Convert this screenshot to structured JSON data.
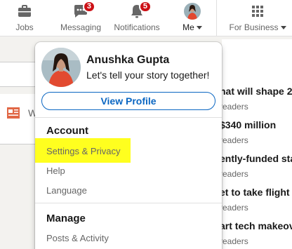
{
  "nav": {
    "jobs_label": "Jobs",
    "messaging_label": "Messaging",
    "messaging_badge": "3",
    "notifications_label": "Notifications",
    "notifications_badge": "5",
    "me_label": "Me",
    "business_label": "For Business",
    "icon_color": "#666666",
    "badge_color": "#cc1016"
  },
  "menu": {
    "name": "Anushka Gupta",
    "headline": "Let's tell your story together!",
    "view_profile": "View Profile",
    "account_title": "Account",
    "account_items": [
      "Settings & Privacy",
      "Help",
      "Language"
    ],
    "manage_title": "Manage",
    "manage_items": [
      "Posts & Activity"
    ],
    "highlight_color": "#ffff1f",
    "accent": "#0a66c2"
  },
  "background": {
    "left_partial": "W",
    "news": [
      {
        "title": "hat will shape 20",
        "sub": "readers"
      },
      {
        "title": "$340 million",
        "sub": "readers"
      },
      {
        "title": "ently-funded sta",
        "sub": "readers"
      },
      {
        "title": "et to take flight",
        "sub": "readers"
      },
      {
        "title": "art tech makeov",
        "sub": "readers"
      }
    ]
  }
}
